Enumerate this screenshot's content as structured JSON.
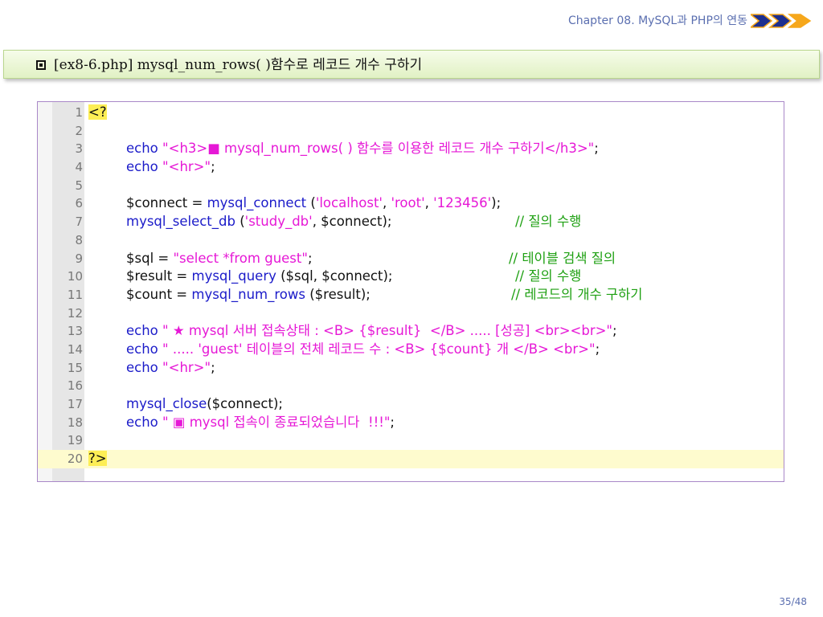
{
  "header": {
    "chapter": "Chapter 08. MySQL과 PHP의 연동"
  },
  "title": {
    "text": "[ex8-6.php]  mysql_num_rows( )함수로 레코드 개수 구하기"
  },
  "code": {
    "l1": {
      "n": "1",
      "t": "<?"
    },
    "l2": {
      "n": "2"
    },
    "l3": {
      "n": "3",
      "a": "echo ",
      "b": "\"<h3>■ mysql_num_rows( ) 함수를 이용한 레코드 개수 구하기</h3>\"",
      "c": ";"
    },
    "l4": {
      "n": "4",
      "a": "echo ",
      "b": "\"<hr>\"",
      "c": ";"
    },
    "l5": {
      "n": "5"
    },
    "l6": {
      "n": "6",
      "a": "$connect = ",
      "b": "mysql_connect",
      "c": " (",
      "d": "'localhost'",
      "e": ", ",
      "f": "'root'",
      "g": ", ",
      "h": "'123456'",
      "i": ");"
    },
    "l7": {
      "n": "7",
      "a": "mysql_select_db",
      "b": " (",
      "c": "'study_db'",
      "d": ", $connect);",
      "cm": "// 질의 수행"
    },
    "l8": {
      "n": "8"
    },
    "l9": {
      "n": "9",
      "a": "$sql = ",
      "b": "\"select *from guest\"",
      "c": ";",
      "cm": "// 테이블 검색 질의"
    },
    "l10": {
      "n": "10",
      "a": "$result = ",
      "b": "mysql_query",
      "c": " ($sql, $connect);",
      "cm": "// 질의 수행"
    },
    "l11": {
      "n": "11",
      "a": "$count = ",
      "b": "mysql_num_rows",
      "c": " ($result);",
      "cm": "// 레코드의 개수 구하기"
    },
    "l12": {
      "n": "12"
    },
    "l13": {
      "n": "13",
      "a": "echo ",
      "b": "\" ★ mysql 서버 접속상태 : <B> {$result}  </B> ..... [성공] <br><br>\"",
      "c": ";"
    },
    "l14": {
      "n": "14",
      "a": "echo ",
      "b": "\" ..... 'guest' 테이블의 전체 레코드 수 : <B> {$count} 개 </B> <br>\"",
      "c": ";"
    },
    "l15": {
      "n": "15",
      "a": "echo ",
      "b": "\"<hr>\"",
      "c": ";"
    },
    "l16": {
      "n": "16"
    },
    "l17": {
      "n": "17",
      "a": "mysql_close",
      "b": "($connect);"
    },
    "l18": {
      "n": "18",
      "a": "echo ",
      "b": "\" ▣ mysql 접속이 종료되었습니다  !!!\"",
      "c": ";"
    },
    "l19": {
      "n": "19"
    },
    "l20": {
      "n": "20",
      "t": "?>"
    }
  },
  "footer": {
    "page": "35/48"
  },
  "colors": {
    "keyword": "#1b1bc9",
    "string": "#e618d6",
    "comment": "#1ea012",
    "tag_highlight": "#fdee55",
    "line_highlight": "#fefbce",
    "title_bar": "#e1f1c4",
    "frame_border": "#a988c8"
  }
}
